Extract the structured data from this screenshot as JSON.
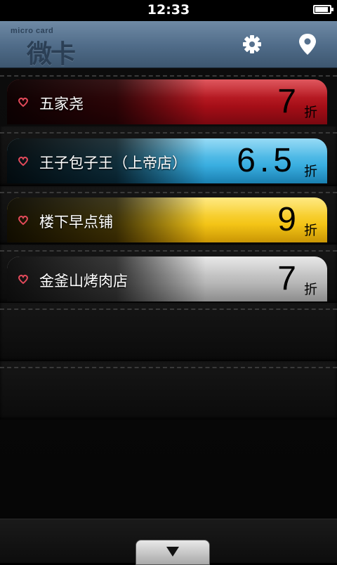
{
  "status_bar": {
    "time": "12:33",
    "battery_level": 1.0
  },
  "header": {
    "logo_small": "micro card",
    "logo_text": "微卡",
    "settings_icon": "gear-icon",
    "location_icon": "location-pin-icon"
  },
  "cards": [
    {
      "name": "五家尧",
      "discount": "7",
      "unit": "折",
      "color": "#b5141d"
    },
    {
      "name": "王子包子王（上帝店）",
      "discount": "6.5",
      "unit": "折",
      "color": "#39aee0"
    },
    {
      "name": "楼下早点铺",
      "discount": "9",
      "unit": "折",
      "color": "#f3c416"
    },
    {
      "name": "金釜山烤肉店",
      "discount": "7",
      "unit": "折",
      "color": "#b6b6b6"
    }
  ],
  "footer": {
    "expand_icon": "triangle-down-icon"
  }
}
